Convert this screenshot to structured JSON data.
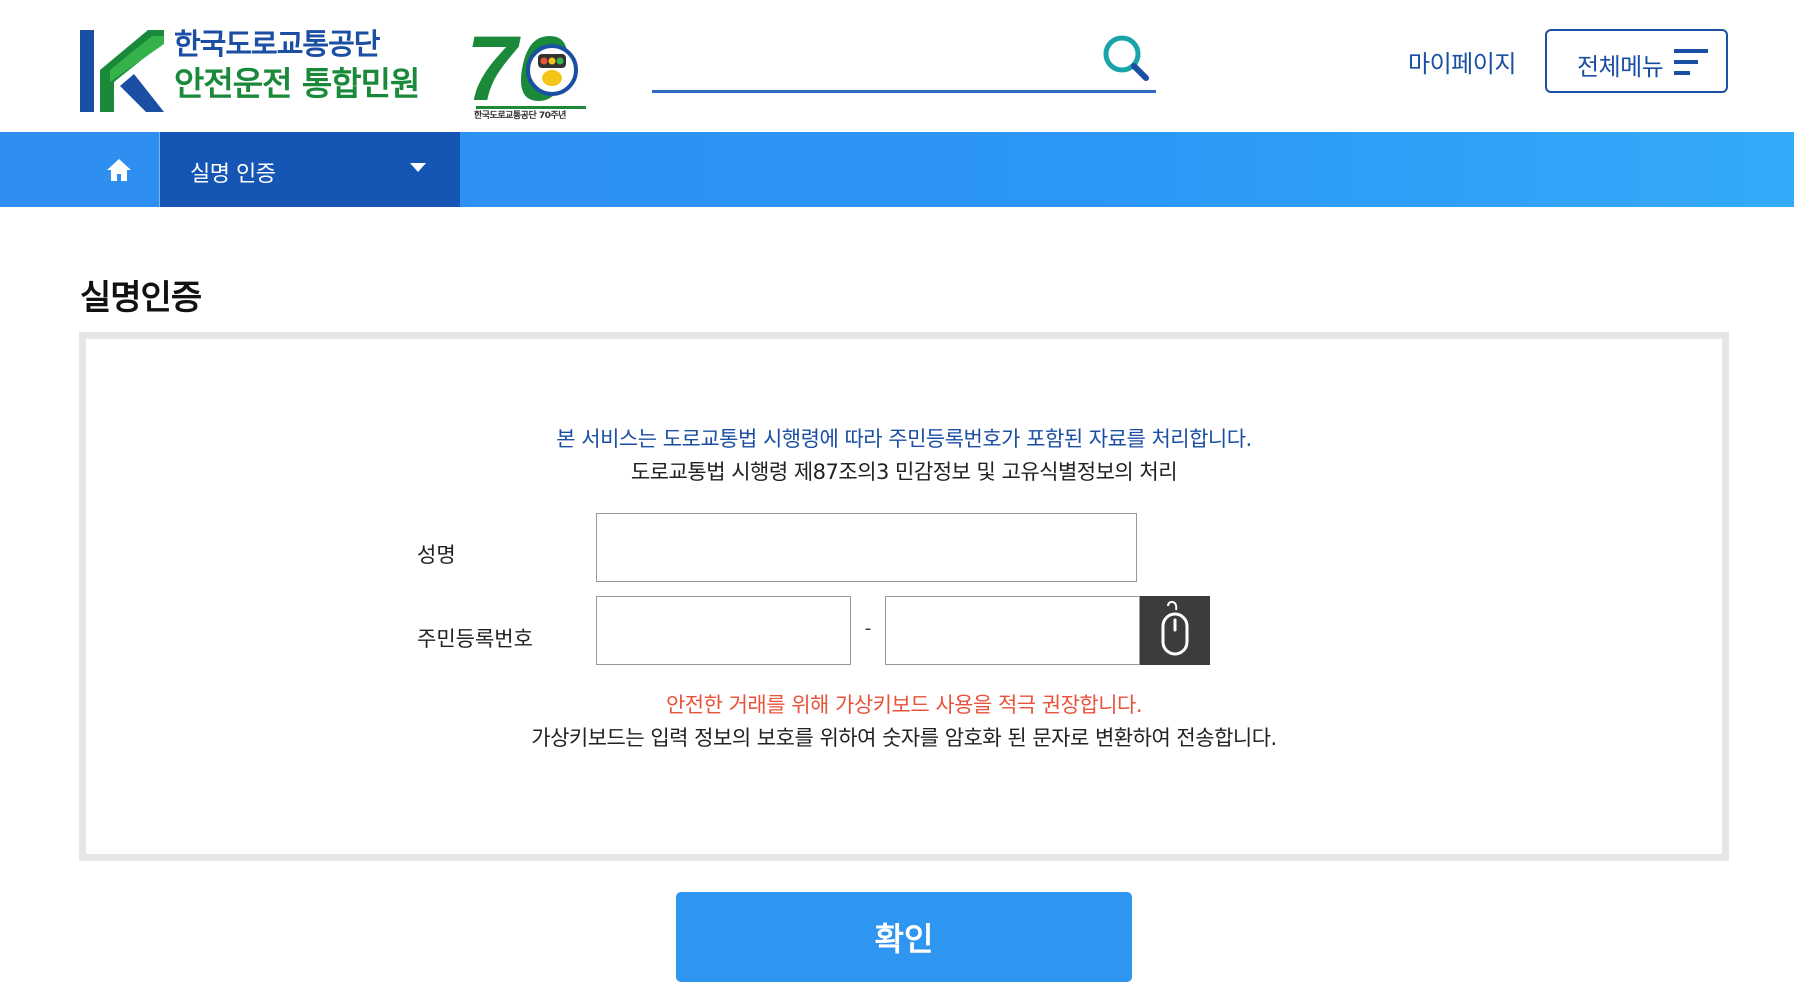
{
  "header": {
    "logo_line1": "한국도로교통공단",
    "logo_line2": "안전운전 통합민원",
    "anniversary_number": "70",
    "anniversary_caption": "한국도로교통공단 70주년",
    "search": {
      "placeholder": "",
      "value": ""
    },
    "mypage_label": "마이페이지",
    "allmenu_label": "전체메뉴"
  },
  "nav": {
    "current_menu": "실명 인증"
  },
  "main": {
    "title": "실명인증",
    "notice_primary": "본 서비스는 도로교통법 시행령에 따라 주민등록번호가 포함된 자료를 처리합니다.",
    "notice_secondary": "도로교통법 시행령 제87조의3 민감정보 및 고유식별정보의 처리",
    "name_label": "성명",
    "name_value": "",
    "rrn_label": "주민등록번호",
    "rrn_front_value": "",
    "rrn_separator": "-",
    "rrn_back_value": "",
    "warning_primary": "안전한 거래를 위해 가상키보드 사용을 적극 권장합니다.",
    "warning_secondary": "가상키보드는 입력 정보의 보호를 위하여 숫자를 암호화 된 문자로 변환하여 전송합니다.",
    "confirm_label": "확인"
  },
  "icons": {
    "search": "search-icon",
    "menu": "hamburger-icon",
    "home": "home-icon",
    "dropdown": "caret-down-icon",
    "virtual_keyboard": "mouse-icon"
  },
  "colors": {
    "brand_blue": "#1b4fa3",
    "brand_green": "#1a8a3a",
    "nav_blue": "#2f8ef0",
    "nav_dark": "#1555b3",
    "warning_red": "#e8533b",
    "button_blue": "#2e95f1"
  }
}
